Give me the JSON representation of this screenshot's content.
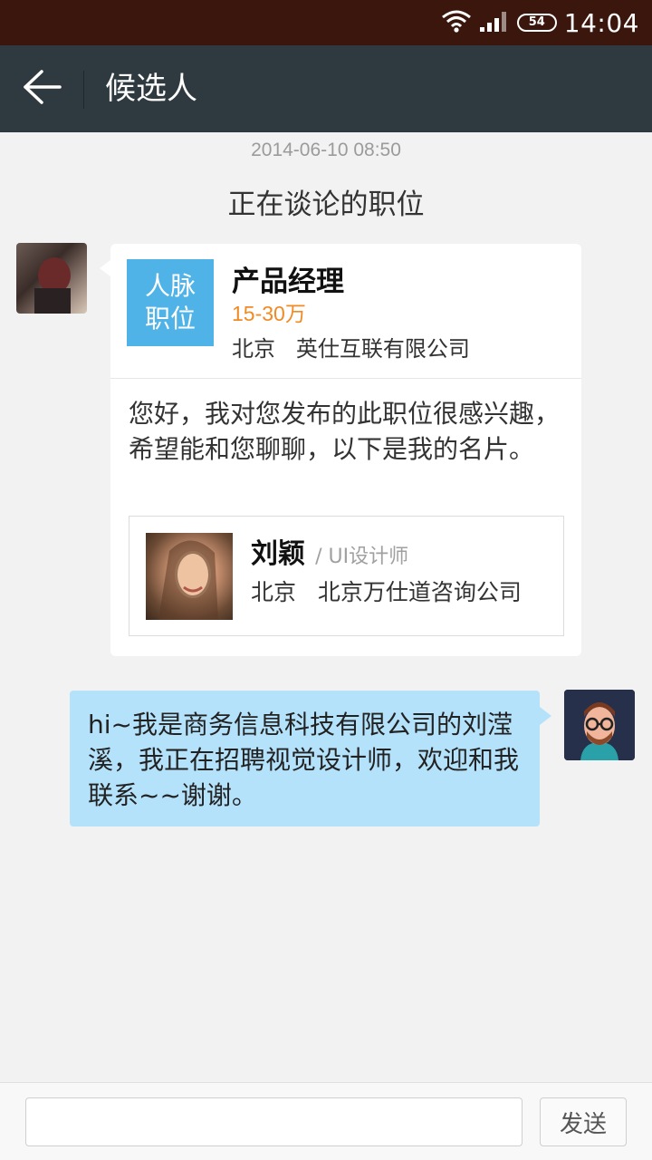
{
  "status_bar": {
    "battery": "54",
    "time": "14:04",
    "icons": [
      "wifi-icon",
      "signal-icon",
      "battery-icon"
    ]
  },
  "app_bar": {
    "back_icon": "back-arrow-icon",
    "title": "候选人"
  },
  "chat": {
    "timestamp": "2014-06-10 08:50",
    "section_title": "正在谈论的职位",
    "job_card": {
      "badge_line1": "人脉",
      "badge_line2": "职位",
      "title": "产品经理",
      "salary": "15-30万",
      "location": "北京   英仕互联有限公司",
      "message": "您好，我对您发布的此职位很感兴趣，希望能和您聊聊，以下是我的名片。",
      "profile": {
        "name": "刘颖",
        "role": "/ UI设计师",
        "location": "北京   北京万仕道咨询公司"
      }
    },
    "reply": {
      "text": "hi~我是商务信息科技有限公司的刘滢溪，我正在招聘视觉设计师，欢迎和我联系~~谢谢。"
    }
  },
  "composer": {
    "input_value": "",
    "input_placeholder": "",
    "send_label": "发送"
  },
  "colors": {
    "status_bar_bg": "#3a160d",
    "app_bar_bg": "#2e3a40",
    "badge_blue": "#4fb3e8",
    "salary_orange": "#f08a24",
    "reply_bubble": "#b5e2fb",
    "chat_bg": "#f2f2f2"
  }
}
